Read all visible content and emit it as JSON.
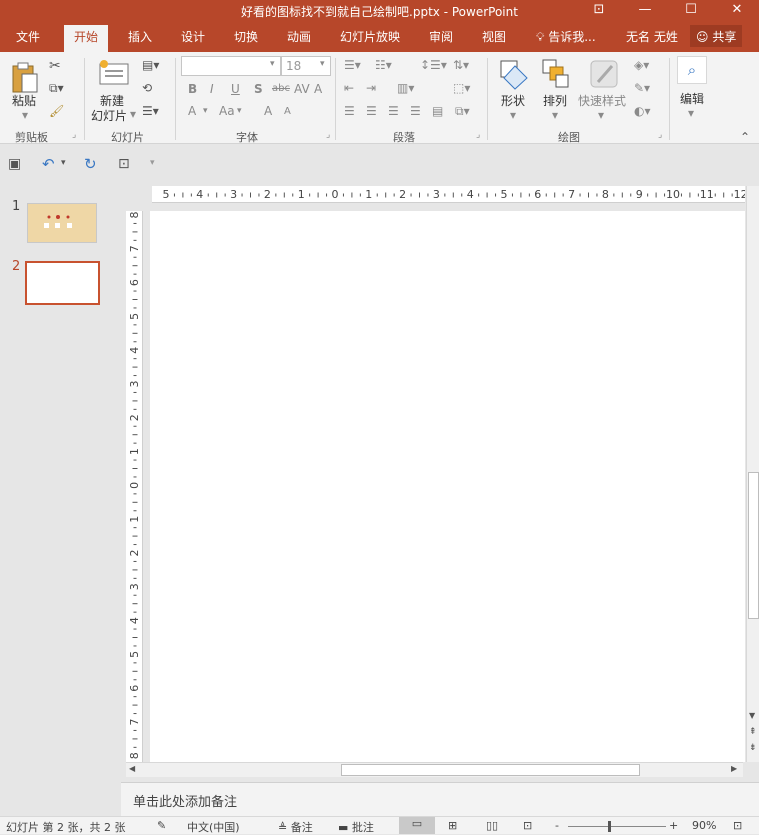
{
  "window": {
    "title": "好看的图标找不到就自己绘制吧.pptx - PowerPoint",
    "controls": {
      "ribbon_display": "⊡",
      "minimize": "—",
      "maximize": "☐",
      "close": "✕"
    }
  },
  "ribbon_tabs": [
    {
      "label": "文件"
    },
    {
      "label": "开始",
      "active": true
    },
    {
      "label": "插入"
    },
    {
      "label": "设计"
    },
    {
      "label": "切换"
    },
    {
      "label": "动画"
    },
    {
      "label": "幻灯片放映"
    },
    {
      "label": "审阅"
    },
    {
      "label": "视图"
    }
  ],
  "tell_me": {
    "icon": "lightbulb-icon",
    "label": "告诉我..."
  },
  "user": {
    "name": "无名 无姓"
  },
  "share": {
    "label": "共享",
    "icon": "person-plus-icon"
  },
  "ribbon": {
    "clipboard": {
      "paste_label": "粘贴",
      "group_label": "剪贴板"
    },
    "slides": {
      "new_slide_line1": "新建",
      "new_slide_line2": "幻灯片",
      "group_label": "幻灯片"
    },
    "font": {
      "font_name": "",
      "font_size": "18",
      "bold": "B",
      "italic": "I",
      "underline": "U",
      "shadow": "S",
      "strike": "abc",
      "spacing": "AV",
      "clear": "A",
      "case": "Aa",
      "grow": "A",
      "shrink": "A",
      "group_label": "字体"
    },
    "paragraph": {
      "group_label": "段落"
    },
    "drawing": {
      "shapes_label": "形状",
      "arrange_label": "排列",
      "quick_styles_label": "快速样式",
      "group_label": "绘图"
    },
    "editing": {
      "label": "编辑"
    },
    "collapse_icon": "caret-up-icon"
  },
  "qat": {
    "save_icon": "save-icon",
    "undo_icon": "undo-icon",
    "redo_icon": "repeat-icon",
    "present_icon": "start-slideshow-icon"
  },
  "slides_pane": {
    "slides": [
      {
        "number": "1"
      },
      {
        "number": "2",
        "selected": true
      }
    ]
  },
  "ruler": {
    "horizontal_labels": [
      "5",
      "4",
      "3",
      "2",
      "1",
      "0",
      "1",
      "2",
      "3",
      "4",
      "5",
      "6",
      "7",
      "8",
      "9",
      "10",
      "11",
      "12"
    ],
    "vertical_labels": [
      "8",
      "7",
      "6",
      "5",
      "4",
      "3",
      "2",
      "1",
      "0",
      "1",
      "2",
      "3",
      "4",
      "5",
      "6",
      "7",
      "8"
    ]
  },
  "notes": {
    "placeholder": "单击此处添加备注"
  },
  "status": {
    "slide_info": "幻灯片 第 2 张，共 2 张",
    "language": "中文(中国)",
    "notes_label": "备注",
    "comments_label": "批注",
    "zoom_minus": "-",
    "zoom_plus": "+",
    "zoom_level": "90%"
  },
  "colors": {
    "accent": "#b7472a",
    "ribbon_bg": "#f3f3f3",
    "workspace_bg": "#e6e6e6"
  }
}
